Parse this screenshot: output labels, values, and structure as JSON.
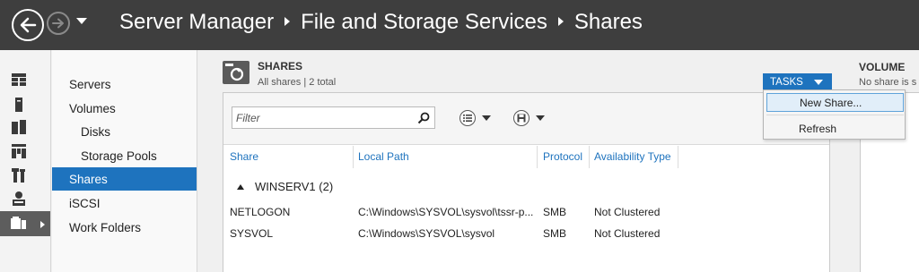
{
  "titlebar": {
    "breadcrumb": [
      "Server Manager",
      "File and Storage Services",
      "Shares"
    ]
  },
  "rail": {
    "icons": [
      "dashboard-icon",
      "local-server-icon",
      "all-servers-icon",
      "file-services-icon",
      "tools-icon",
      "users-icon",
      "file-storage-icon"
    ]
  },
  "nav": {
    "items": [
      {
        "label": "Servers",
        "indent": 0
      },
      {
        "label": "Volumes",
        "indent": 0
      },
      {
        "label": "Disks",
        "indent": 1
      },
      {
        "label": "Storage Pools",
        "indent": 1
      },
      {
        "label": "Shares",
        "indent": 0,
        "active": true
      },
      {
        "label": "iSCSI",
        "indent": 0
      },
      {
        "label": "Work Folders",
        "indent": 0
      }
    ]
  },
  "shares": {
    "title": "SHARES",
    "subtitle": "All shares | 2 total",
    "tasks_label": "TASKS",
    "filter_placeholder": "Filter",
    "columns": [
      "Share",
      "Local Path",
      "Protocol",
      "Availability Type"
    ],
    "group": "WINSERV1 (2)",
    "rows": [
      {
        "share": "NETLOGON",
        "path": "C:\\Windows\\SYSVOL\\sysvol\\tssr-p...",
        "protocol": "SMB",
        "availability": "Not Clustered"
      },
      {
        "share": "SYSVOL",
        "path": "C:\\Windows\\SYSVOL\\sysvol",
        "protocol": "SMB",
        "availability": "Not Clustered"
      }
    ]
  },
  "volume": {
    "title": "VOLUME",
    "subtitle": "No share is s"
  },
  "tasks_menu": {
    "items": [
      "New Share...",
      "Refresh"
    ]
  },
  "colors": {
    "accent": "#1e73be",
    "titlebar": "#3e3e3e"
  }
}
